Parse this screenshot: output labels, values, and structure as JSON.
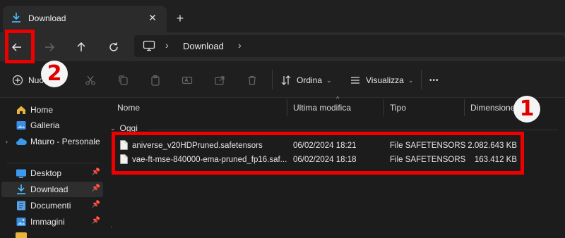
{
  "window": {
    "tab_title": "Download",
    "tab_close": "✕",
    "new_tab": "+"
  },
  "address_bar": {
    "separator": "›",
    "crumb": "Download"
  },
  "command_bar": {
    "new_label": "Nuovo",
    "sort_label": "Ordina",
    "view_label": "Visualizza",
    "more_label": "•••"
  },
  "sidebar": {
    "items": [
      {
        "label": "Home",
        "icon": "home-icon"
      },
      {
        "label": "Galleria",
        "icon": "gallery-icon"
      },
      {
        "label": "Mauro - Personale",
        "icon": "cloud-icon"
      },
      {
        "label": "Desktop",
        "icon": "desktop-icon",
        "pinned": true
      },
      {
        "label": "Download",
        "icon": "download-icon",
        "pinned": true,
        "selected": true
      },
      {
        "label": "Documenti",
        "icon": "documents-icon",
        "pinned": true
      },
      {
        "label": "Immagini",
        "icon": "pictures-icon",
        "pinned": true
      }
    ],
    "pin_glyph": "📌"
  },
  "file_list": {
    "columns": {
      "name": "Nome",
      "modified": "Ultima modifica",
      "type": "Tipo",
      "size": "Dimensione"
    },
    "group": "Oggi",
    "rows": [
      {
        "name": "aniverse_v20HDPruned.safetensors",
        "modified": "06/02/2024 18:21",
        "type": "File SAFETENSORS",
        "size": "2.082.643 KB"
      },
      {
        "name": "vae-ft-mse-840000-ema-pruned_fp16.saf...",
        "modified": "06/02/2024 18:18",
        "type": "File SAFETENSORS",
        "size": "163.412 KB"
      }
    ]
  },
  "annotations": {
    "badge1": "1",
    "badge2": "2",
    "color": "#ee0000"
  },
  "colors": {
    "accent": "#4cc2ff",
    "folder": "#e8b43a",
    "background": "#1c1c1c"
  }
}
